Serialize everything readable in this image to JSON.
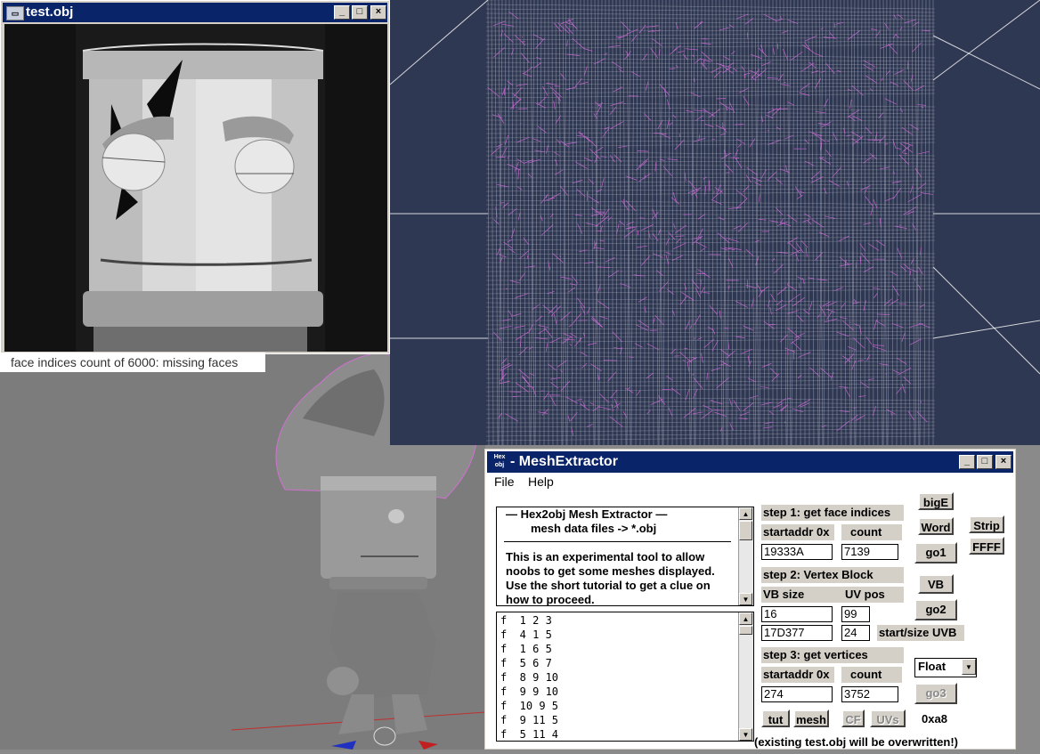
{
  "obj_window": {
    "title": "test.obj",
    "buttons": [
      "_",
      "□",
      "×"
    ]
  },
  "caption": "face indices count of 6000: missing faces",
  "mesh_window": {
    "icon_text": "Hex obj",
    "title": "- MeshExtractor",
    "menu": [
      "File",
      "Help"
    ],
    "info_lines": [
      "—   Hex2obj Mesh Extractor   —",
      "mesh data files -> *.obj",
      "This is an experimental tool to allow",
      "noobs to get some meshes displayed.",
      "Use the short tutorial to get a clue on",
      "how to proceed."
    ],
    "faces": [
      "f  1 2 3",
      "f  4 1 5",
      "f  1 6 5",
      "f  5 6 7",
      "f  8 9 10",
      "f  9 9 10",
      "f  10 9 5",
      "f  9 11 5",
      "f  5 11 4"
    ],
    "step1": {
      "label": "step 1: get face indices",
      "startaddr_label": "startaddr 0x",
      "count_label": "count",
      "startaddr": "19333A",
      "count": "7139"
    },
    "step2": {
      "label": "step 2: Vertex Block",
      "vbsize_label": "VB size",
      "uvpos_label": "UV pos",
      "vbsize": "16",
      "uvpos": "99",
      "uvb_start": "17D377",
      "uvb_size": "24",
      "uvb_label": "start/size UVB"
    },
    "step3": {
      "label": "step 3: get vertices",
      "startaddr_label": "startaddr 0x",
      "count_label": "count",
      "startaddr": "274",
      "count": "3752"
    },
    "buttons": {
      "bigE": "bigE",
      "word": "Word",
      "strip": "Strip",
      "ffff": "FFFF",
      "go1": "go1",
      "vb": "VB",
      "go2": "go2",
      "go3": "go3",
      "tut": "tut",
      "mesh": "mesh",
      "cf": "CF",
      "uvs": "UVs"
    },
    "float_select": "Float",
    "hex_value": "0xa8",
    "footer": "(existing test.obj will be overwritten!)"
  }
}
